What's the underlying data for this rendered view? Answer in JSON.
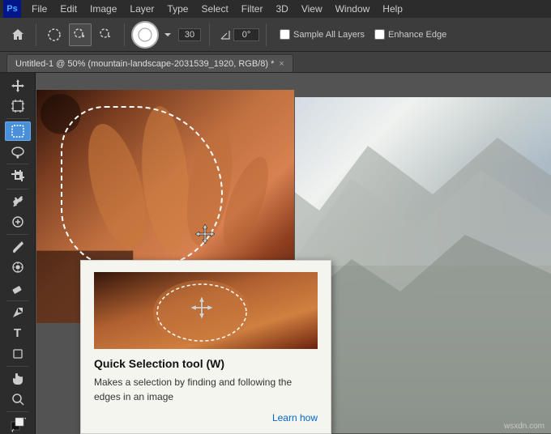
{
  "menubar": {
    "logo": "Ps",
    "items": [
      "File",
      "Edit",
      "Image",
      "Layer",
      "Type",
      "Select",
      "Filter",
      "3D",
      "View",
      "Window",
      "Help"
    ]
  },
  "toolbar": {
    "brush_size": "30",
    "angle_label": "°",
    "angle_value": "0°",
    "sample_all_layers_label": "Sample All Layers",
    "enhance_edge_label": "Enhance Edge",
    "sample_checked": false,
    "enhance_checked": false
  },
  "tab": {
    "title": "Untitled-1 @ 50% (mountain-landscape-2031539_1920, RGB/8) *",
    "close": "×"
  },
  "tooltip": {
    "title": "Quick Selection tool (W)",
    "description": "Makes a selection by finding and following the edges in an image",
    "link": "Learn how"
  },
  "watermark": "wsxdn.com",
  "icons": {
    "home": "⌂",
    "brush": "⬤",
    "lasso": "○",
    "quick_select": "◎",
    "brush2": "⊙",
    "move": "✛",
    "select_rect": "⬚",
    "lasso2": "◌",
    "magic_wand": "✦",
    "crop": "⤢",
    "eyedropper": "⊕",
    "spot_heal": "⊘",
    "brush3": "✏",
    "clone": "⊗",
    "eraser": "▭",
    "gradient": "▦",
    "blur": "◍",
    "dodge": "◑",
    "pen": "✒",
    "text": "T",
    "shape": "▲",
    "hand": "☜",
    "zoom": "⊕",
    "fg_bg": "◼"
  }
}
